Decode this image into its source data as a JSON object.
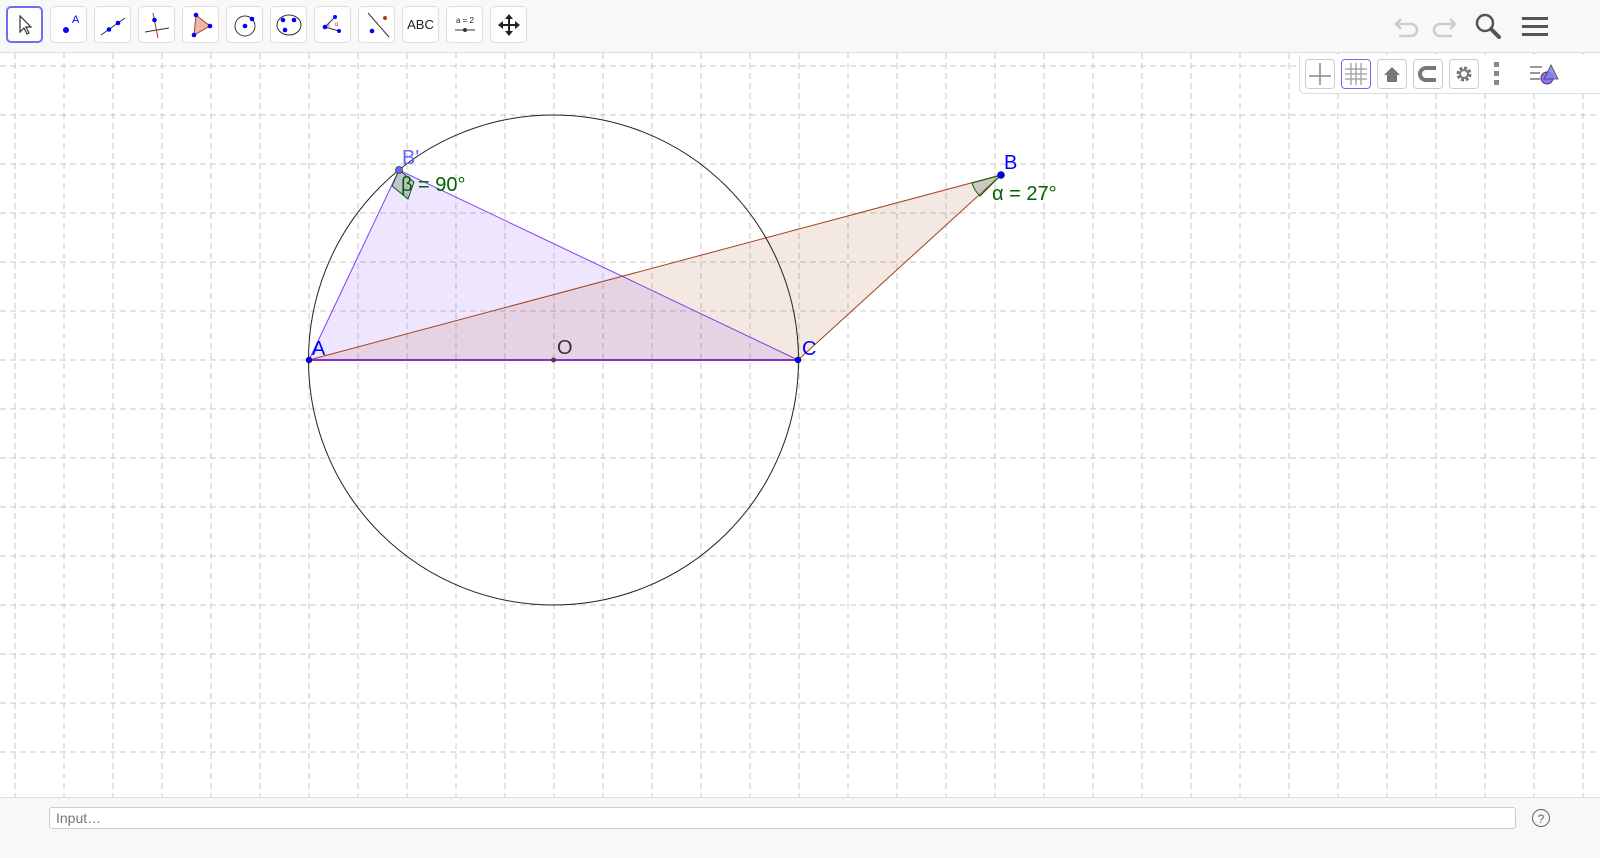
{
  "toolbar": {
    "tools": [
      {
        "name": "move",
        "icon": "arrow-cursor-icon"
      },
      {
        "name": "point",
        "icon": "point-icon",
        "label": "A"
      },
      {
        "name": "line",
        "icon": "line-icon"
      },
      {
        "name": "perpendicular",
        "icon": "perpendicular-line-icon"
      },
      {
        "name": "polygon",
        "icon": "polygon-icon"
      },
      {
        "name": "circle",
        "icon": "circle-center-point-icon"
      },
      {
        "name": "circle-three-points",
        "icon": "circle-three-points-icon"
      },
      {
        "name": "angle",
        "icon": "angle-icon",
        "label": "α"
      },
      {
        "name": "reflect",
        "icon": "reflect-line-icon"
      },
      {
        "name": "text",
        "icon": "text-icon",
        "label": "ABC"
      },
      {
        "name": "slider",
        "icon": "slider-icon",
        "label": "a = 2"
      },
      {
        "name": "move-graphics",
        "icon": "move-graphics-icon"
      }
    ],
    "selected": "move"
  },
  "style_bar": {
    "grid_active": true
  },
  "construction": {
    "points": {
      "A": "A",
      "B": "B",
      "B_prime": "B'",
      "C": "C",
      "O": "O"
    },
    "angles": {
      "beta": "β = 90°",
      "alpha": "α = 27°"
    },
    "colors": {
      "purple": "#7f3fff",
      "brown": "#a5421a",
      "angle_green": "#006400",
      "point_blue": "#0000ff",
      "light_point": "#6666ff"
    }
  },
  "input_bar": {
    "placeholder": "Input…",
    "help": "?"
  }
}
